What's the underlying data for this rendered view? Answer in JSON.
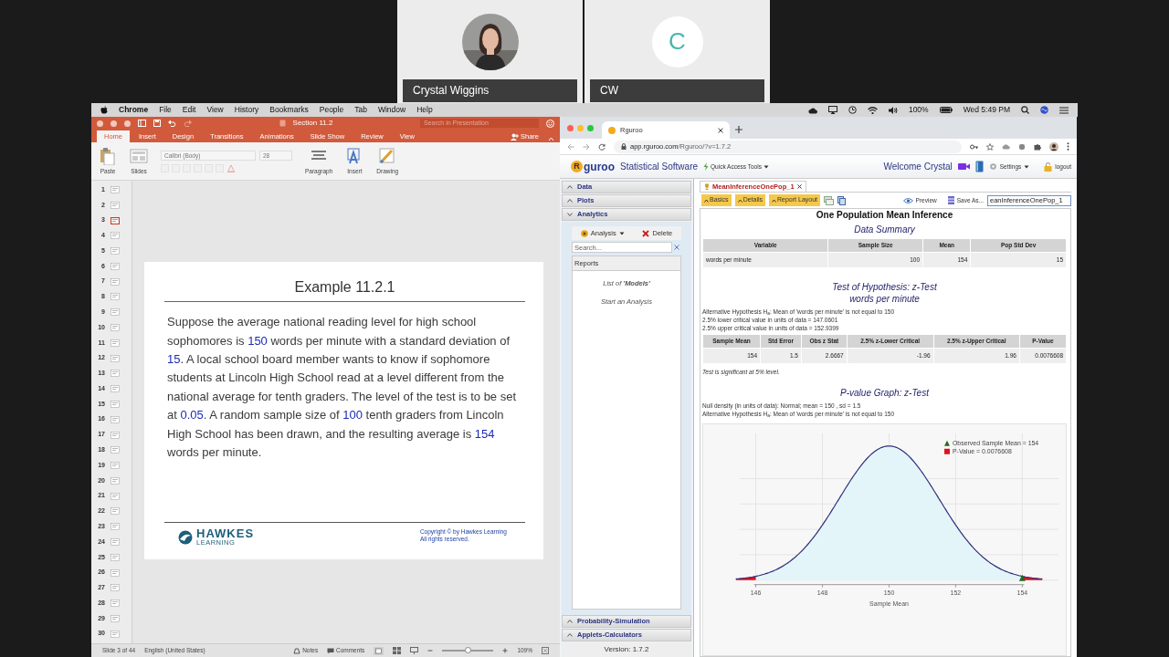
{
  "video_tiles": [
    {
      "kind": "picture",
      "name": "Crystal Wiggins"
    },
    {
      "kind": "initial",
      "initial": "C",
      "name": "CW"
    }
  ],
  "menu_bar": {
    "app": "Chrome",
    "items": [
      "File",
      "Edit",
      "View",
      "History",
      "Bookmarks",
      "People",
      "Tab",
      "Window",
      "Help"
    ],
    "battery": "100%",
    "clock": "Wed 5:49 PM"
  },
  "powerpoint": {
    "title": "Section 11.2",
    "search": {
      "placeholder": "Search in Presentation"
    },
    "share": "Share",
    "tabs": [
      {
        "label": "Home",
        "selected": true
      },
      {
        "label": "Insert",
        "selected": false
      },
      {
        "label": "Design",
        "selected": false
      },
      {
        "label": "Transitions",
        "selected": false
      },
      {
        "label": "Animations",
        "selected": false
      },
      {
        "label": "Slide Show",
        "selected": false
      },
      {
        "label": "Review",
        "selected": false
      },
      {
        "label": "View",
        "selected": false
      }
    ],
    "ribbon": [
      {
        "kind": "paste",
        "label": "Paste"
      },
      {
        "kind": "slides",
        "label": "Slides"
      },
      {
        "kind": "font",
        "font": "Calibri (Body)",
        "size": "28",
        "disabled": true
      },
      {
        "kind": "paragraph",
        "label": "Paragraph"
      },
      {
        "kind": "insert",
        "label": "Insert"
      },
      {
        "kind": "drawing",
        "label": "Drawing"
      }
    ],
    "thumbnails": [
      {
        "number": "1",
        "selected": false
      },
      {
        "number": "2",
        "selected": false
      },
      {
        "number": "3",
        "selected": true
      },
      {
        "number": "4",
        "selected": false
      },
      {
        "number": "5",
        "selected": false
      },
      {
        "number": "6",
        "selected": false
      },
      {
        "number": "7",
        "selected": false
      },
      {
        "number": "8",
        "selected": false
      },
      {
        "number": "9",
        "selected": false
      },
      {
        "number": "10",
        "selected": false
      },
      {
        "number": "11",
        "selected": false
      },
      {
        "number": "12",
        "selected": false
      },
      {
        "number": "13",
        "selected": false
      },
      {
        "number": "14",
        "selected": false
      },
      {
        "number": "15",
        "selected": false
      },
      {
        "number": "16",
        "selected": false
      },
      {
        "number": "17",
        "selected": false
      },
      {
        "number": "18",
        "selected": false
      },
      {
        "number": "19",
        "selected": false
      },
      {
        "number": "20",
        "selected": false
      },
      {
        "number": "21",
        "selected": false
      },
      {
        "number": "22",
        "selected": false
      },
      {
        "number": "23",
        "selected": false
      },
      {
        "number": "24",
        "selected": false
      },
      {
        "number": "25",
        "selected": false
      },
      {
        "number": "26",
        "selected": false
      },
      {
        "number": "27",
        "selected": false
      },
      {
        "number": "28",
        "selected": false
      },
      {
        "number": "29",
        "selected": false
      },
      {
        "number": "30",
        "selected": false
      }
    ],
    "slide": {
      "title": "Example 11.2.1",
      "body": [
        {
          "text": "Suppose the average national reading level for high school sophomores is ",
          "highlight": false
        },
        {
          "text": "150",
          "highlight": true
        },
        {
          "text": " words per minute with a standard deviation of ",
          "highlight": false
        },
        {
          "text": "15",
          "highlight": true
        },
        {
          "text": ". A local school board member wants to know if sophomore students at Lincoln High School read at a level different from the national average for tenth graders. The level of the test is to be set at ",
          "highlight": false
        },
        {
          "text": "0.05",
          "highlight": true
        },
        {
          "text": ". A random sample size of ",
          "highlight": false
        },
        {
          "text": "100",
          "highlight": true
        },
        {
          "text": " tenth graders from Lincoln High School has been drawn, and the resulting average is ",
          "highlight": false
        },
        {
          "text": "154",
          "highlight": true
        },
        {
          "text": " words per minute.",
          "highlight": false
        }
      ],
      "logo_name": "HAWKES",
      "logo_sub": "LEARNING",
      "copyright": [
        "Copyright © by Hawkes Learning",
        "All rights reserved."
      ]
    },
    "status_bar": {
      "slide": "Slide 3 of 44",
      "language": "English (United States)",
      "notes": "Notes",
      "comments": "Comments",
      "zoom": "109%",
      "level": 0.5
    }
  },
  "browser": {
    "tab": "Rguroo",
    "url_host": "app.rguroo.com",
    "url_path": "/Rguroo/?v=1.7.2"
  },
  "rguroo": {
    "header": {
      "logo_mark": "R",
      "logo_text": "guroo",
      "product": "Statistical Software",
      "quick_tools": "Quick Access Tools",
      "welcome": "Welcome Crystal",
      "settings": "Settings",
      "logout": "logout"
    },
    "sidebar": {
      "sections_top": [
        {
          "label": "Data",
          "expanded": false
        },
        {
          "label": "Plots",
          "expanded": false
        },
        {
          "label": "Analytics",
          "expanded": true
        }
      ],
      "analysis_button": "Analysis",
      "delete_button": "Delete",
      "search": {
        "placeholder": "Search..."
      },
      "list_header": "Reports",
      "list_items": [
        "List of **'Models'**",
        "Start an Analysis"
      ],
      "sections_bottom": [
        {
          "label": "Probability-Simulation",
          "expanded": false
        },
        {
          "label": "Applets-Calculators",
          "expanded": false
        }
      ],
      "version": "Version: 1.7.2"
    },
    "document": {
      "tab": "MeanInferenceOnePop_1",
      "buttons": [
        "Basics",
        "Details",
        "Report Layout"
      ],
      "preview": "Preview",
      "save_as": "Save As...",
      "name_field": "eanInferenceOnePop_1"
    },
    "report": {
      "title": "One Population Mean Inference",
      "summary": {
        "title": "Data Summary",
        "columns": [
          "Variable",
          "Sample Size",
          "Mean",
          "Pop Std Dev"
        ],
        "rows": [
          [
            "words per minute",
            "100",
            "154",
            "15"
          ]
        ]
      },
      "test": {
        "title_lines": [
          "Test of Hypothesis: z-Test",
          "words per minute"
        ],
        "notes": [
          "Alternative Hypothesis H$_{a}$: Mean of 'words per minute' is not equal to 150",
          "2.5% lower critical value in units of data = 147.0601",
          "2.5% upper critical value in units of data = 152.9399"
        ],
        "columns": [
          "Sample Mean",
          "Std Error",
          "Obs z Stat",
          "2.5% z-Lower Critical",
          "2.5% z-Upper Critical",
          "P-Value"
        ],
        "rows": [
          [
            "154",
            "1.5",
            "2.6667",
            "-1.96",
            "1.96",
            "0.0076608"
          ]
        ],
        "conclusion": "Test is significant at 5% level."
      },
      "graph": {
        "title": "P-value Graph: z-Test",
        "notes": [
          "Null density (in units of data): Normal; mean = 150 , sd = 1.5",
          "Alternative Hypothesis H$_{a}$: Mean of 'words per minute' is not equal to 150"
        ],
        "xticks": [
          "146",
          "148",
          "150",
          "152",
          "154"
        ],
        "xlabel": "Sample Mean",
        "legend": [
          {
            "kind": "triangle",
            "label": "Observed Sample Mean = 154",
            "color": "#1b6e1b"
          },
          {
            "kind": "square",
            "label": "P-Value = 0.0076608",
            "color": "#e01020"
          }
        ]
      }
    }
  }
}
